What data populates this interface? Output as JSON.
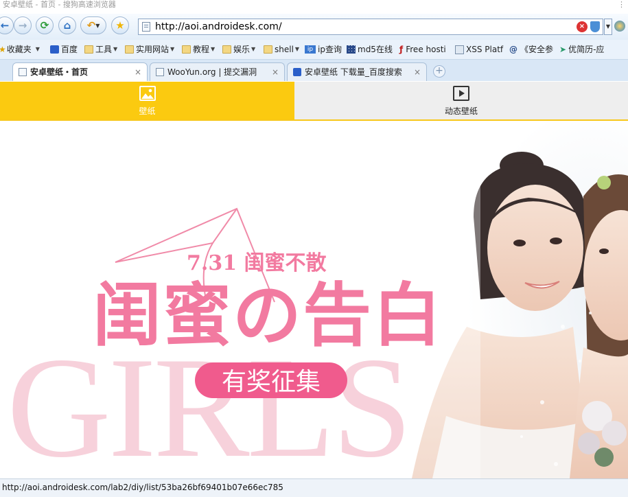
{
  "window": {
    "title": "安卓壁纸 - 首页 - 搜狗高速浏览器"
  },
  "toolbar": {
    "url": "http://aoi.androidesk.com/"
  },
  "bookmarks": [
    {
      "label": "收藏夹",
      "icon": "star-icon"
    },
    {
      "label": "百度",
      "icon": "paw-icon"
    },
    {
      "label": "工具",
      "icon": "folder-icon"
    },
    {
      "label": "实用网站",
      "icon": "folder-icon"
    },
    {
      "label": "教程",
      "icon": "folder-icon"
    },
    {
      "label": "娱乐",
      "icon": "folder-icon"
    },
    {
      "label": "shell",
      "icon": "folder-icon"
    },
    {
      "label": "ip查询",
      "icon": "ip-icon"
    },
    {
      "label": "md5在线",
      "icon": "grid-icon"
    },
    {
      "label": "Free hosti",
      "icon": "flame-icon"
    },
    {
      "label": "XSS Platf",
      "icon": "page-icon"
    },
    {
      "label": "《安全参",
      "icon": "globe-icon"
    },
    {
      "label": "优简历-应",
      "icon": "send-icon"
    }
  ],
  "tabs": [
    {
      "label": "安卓壁纸・首页",
      "active": true
    },
    {
      "label": "WooYun.org | 提交漏洞",
      "active": false
    },
    {
      "label": "安卓壁纸 下载量_百度搜索",
      "active": false
    }
  ],
  "site_nav": [
    {
      "label": "壁纸",
      "active": true,
      "icon": "image-icon"
    },
    {
      "label": "动态壁纸",
      "active": false,
      "icon": "play-icon"
    }
  ],
  "banner": {
    "date_text": "7.31 闺蜜不散",
    "headline": "闺蜜の告白",
    "button": "有奖征集",
    "bg_text": "GIRLS"
  },
  "status": {
    "url": "http://aoi.androidesk.com/lab2/diy/list/53ba26bf69401b07e66ec785"
  },
  "colors": {
    "accent": "#fbca10",
    "banner_pink": "#f27aa0"
  }
}
